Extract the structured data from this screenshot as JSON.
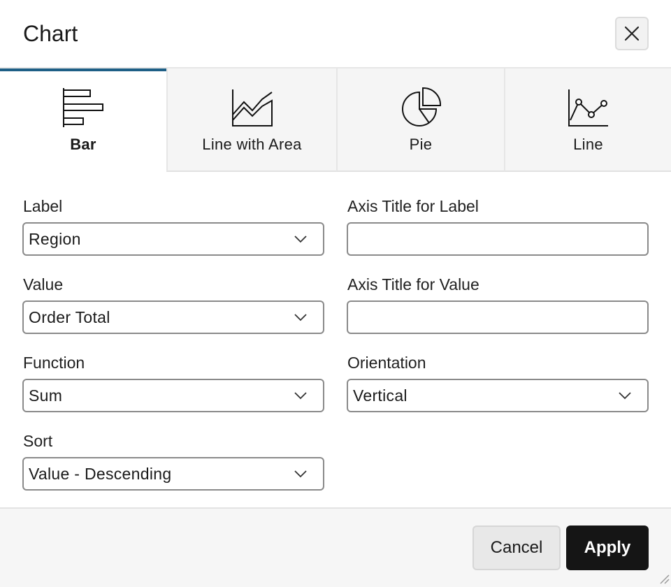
{
  "dialog": {
    "title": "Chart",
    "close_icon": "close-icon"
  },
  "tabs": [
    {
      "label": "Bar",
      "icon": "bar-chart-icon",
      "active": true
    },
    {
      "label": "Line with Area",
      "icon": "area-chart-icon",
      "active": false
    },
    {
      "label": "Pie",
      "icon": "pie-chart-icon",
      "active": false
    },
    {
      "label": "Line",
      "icon": "line-chart-icon",
      "active": false
    }
  ],
  "form": {
    "label": {
      "title": "Label",
      "value": "Region"
    },
    "axis_title_label": {
      "title": "Axis Title for Label",
      "value": ""
    },
    "value": {
      "title": "Value",
      "value": "Order Total"
    },
    "axis_title_value": {
      "title": "Axis Title for Value",
      "value": ""
    },
    "function": {
      "title": "Function",
      "value": "Sum"
    },
    "orientation": {
      "title": "Orientation",
      "value": "Vertical"
    },
    "sort": {
      "title": "Sort",
      "value": "Value - Descending"
    }
  },
  "footer": {
    "cancel_label": "Cancel",
    "apply_label": "Apply"
  },
  "colors": {
    "active_tab_accent": "#1e5f86",
    "primary_button": "#151515"
  }
}
